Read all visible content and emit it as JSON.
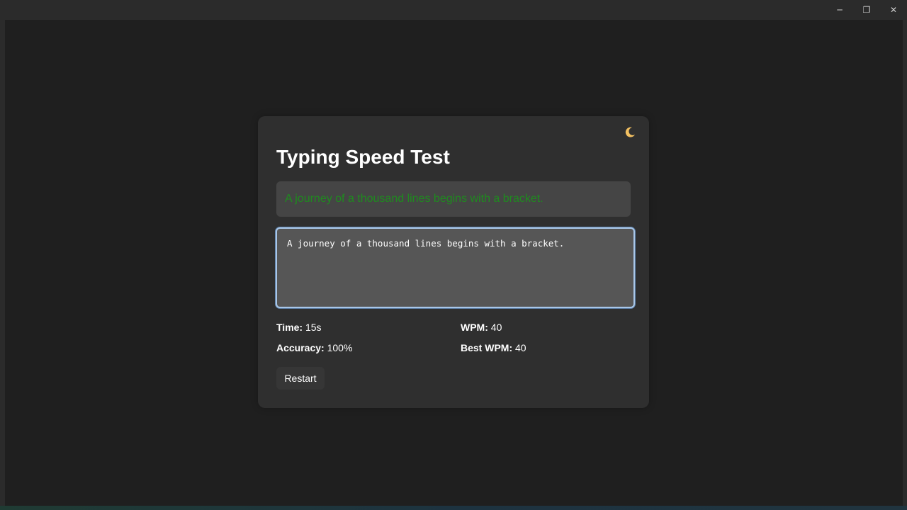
{
  "window": {
    "minimize_icon": "minimize-icon",
    "maximize_icon": "restore-icon",
    "close_icon": "close-icon"
  },
  "theme_toggle": {
    "icon": "moon-icon",
    "color": "#f2c061"
  },
  "app": {
    "title": "Typing Speed Test",
    "prompt_text": "A journey of a thousand lines begins with a bracket.",
    "prompt_color": "#1f8a1f",
    "typed_value": "A journey of a thousand lines begins with a bracket."
  },
  "stats": {
    "time_label": "Time:",
    "time_value": "15s",
    "wpm_label": "WPM:",
    "wpm_value": "40",
    "accuracy_label": "Accuracy:",
    "accuracy_value": "100%",
    "best_wpm_label": "Best WPM:",
    "best_wpm_value": "40"
  },
  "actions": {
    "restart_label": "Restart"
  }
}
